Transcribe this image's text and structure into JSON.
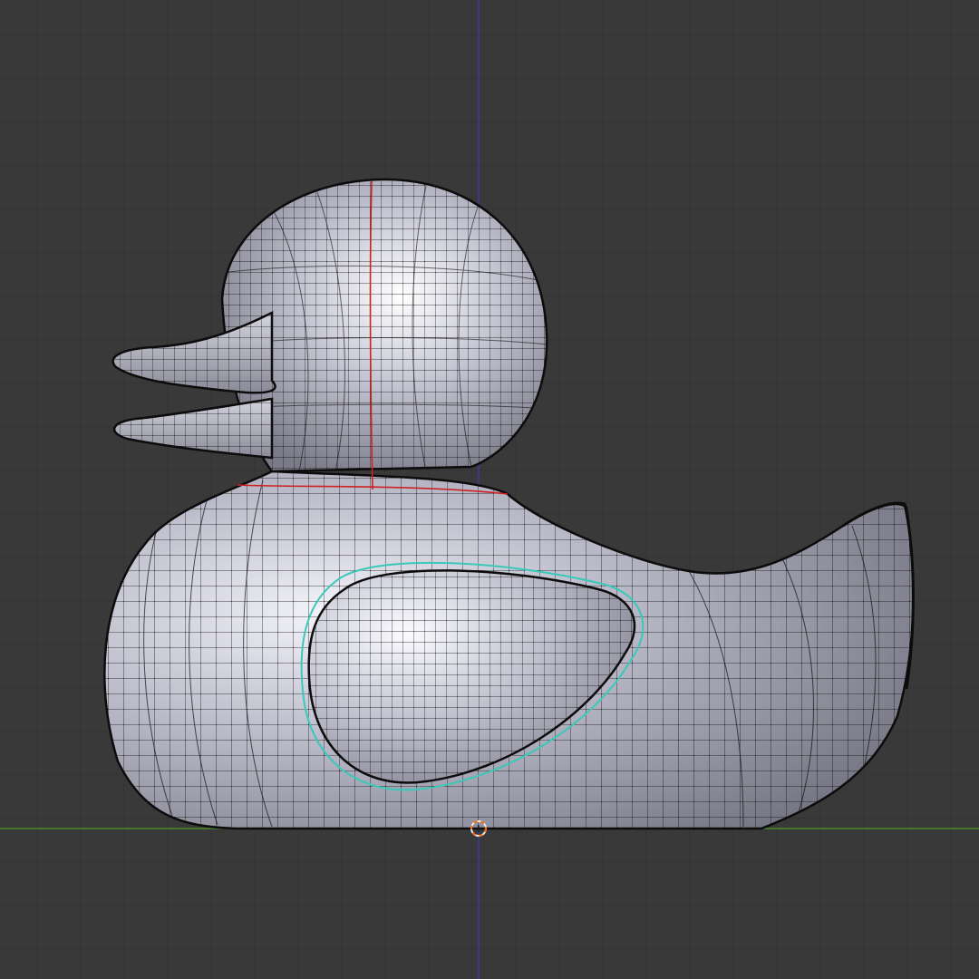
{
  "viewport": {
    "view": "right-orthographic",
    "background_color": "#393939",
    "grid_color": "#2f2f2f",
    "grid": true
  },
  "axes": {
    "z_axis_color": "#3a3aa8",
    "y_axis_color": "#4a8a2a"
  },
  "object": {
    "name": "rubber-duck",
    "shading": "solid",
    "wireframe_overlay": true,
    "surface_color": "#b8b8c6",
    "wire_color": "#111111"
  },
  "seams": {
    "color": "#cc2222",
    "visible": true
  },
  "selected_edge_loop": {
    "color": "#3ac8b8",
    "location": "wing"
  },
  "cursor_3d": {
    "visible": true,
    "ring_color": "#e8e8e8",
    "accent_color": "#ff6a00"
  }
}
